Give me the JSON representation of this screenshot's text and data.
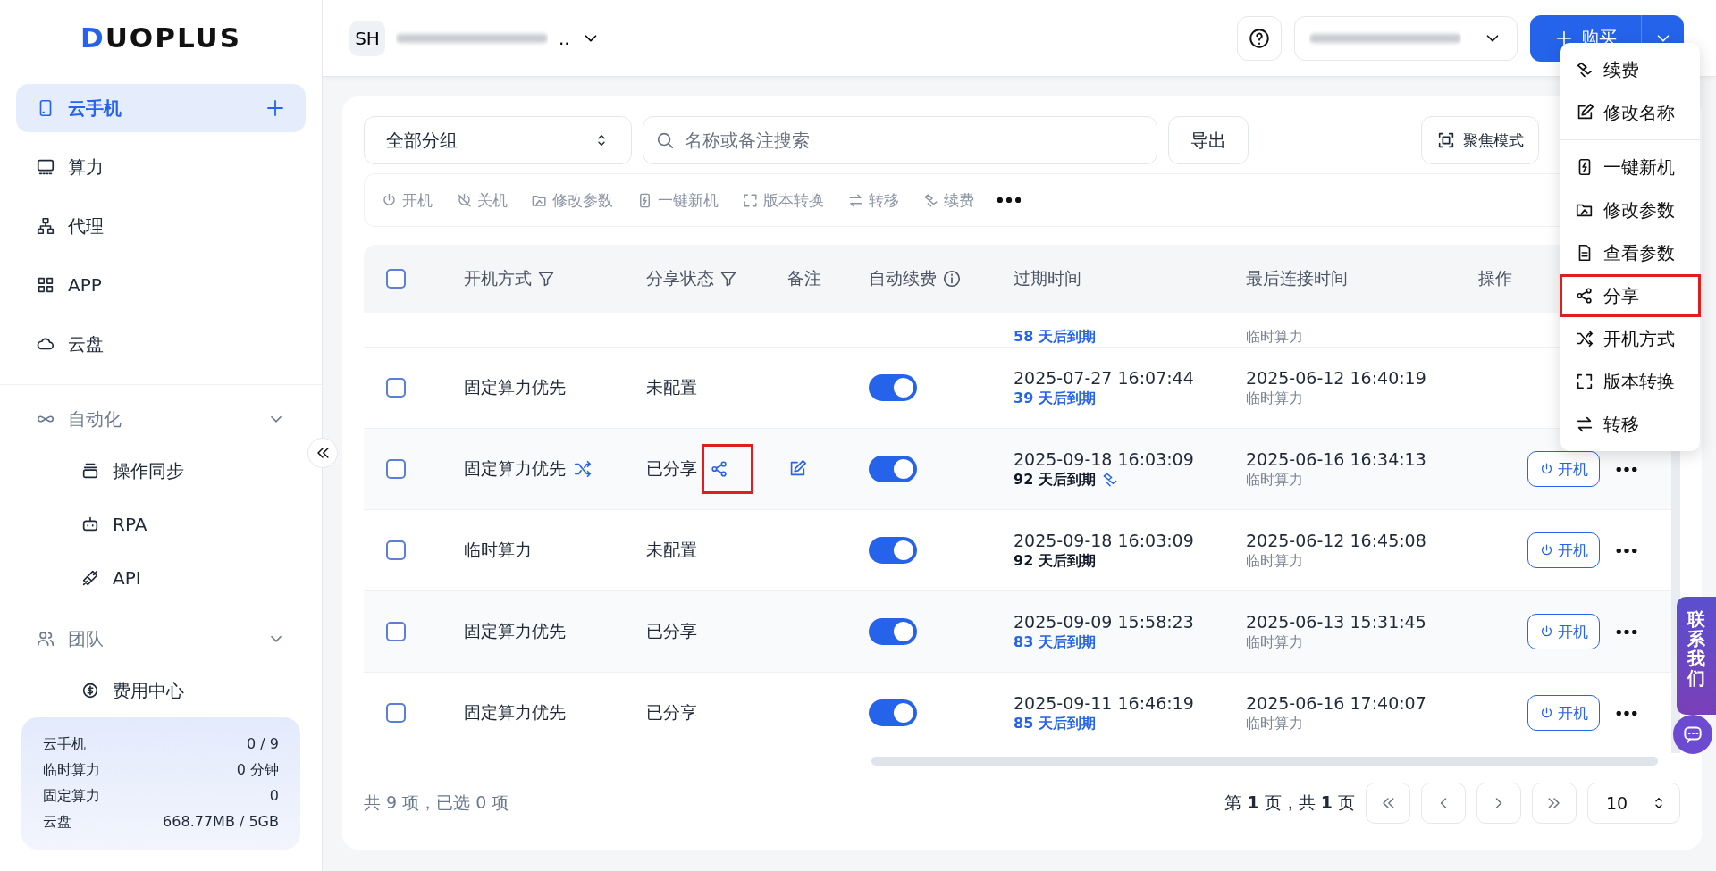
{
  "sidebar": {
    "logo": "DUOPLUS",
    "items": [
      {
        "label": "云手机",
        "selected": true
      },
      {
        "label": "算力",
        "selected": false
      },
      {
        "label": "代理",
        "selected": false
      },
      {
        "label": "APP",
        "selected": false
      },
      {
        "label": "云盘",
        "selected": false
      }
    ],
    "groups": [
      {
        "label": "自动化",
        "expanded": true,
        "children": [
          {
            "label": "操作同步"
          },
          {
            "label": "RPA"
          },
          {
            "label": "API"
          }
        ]
      },
      {
        "label": "团队",
        "expanded": true,
        "children": [
          {
            "label": "费用中心"
          }
        ]
      }
    ],
    "stats": [
      {
        "label": "云手机",
        "value": "0 / 9"
      },
      {
        "label": "临时算力",
        "value": "0 分钟"
      },
      {
        "label": "固定算力",
        "value": "0"
      },
      {
        "label": "云盘",
        "value": "668.77MB / 5GB"
      }
    ]
  },
  "header": {
    "avatar": "SH",
    "account_suffix": "..",
    "buy": "购买"
  },
  "filters": {
    "group": "全部分组",
    "search_placeholder": "名称或备注搜索",
    "export": "导出",
    "focus": "聚焦模式"
  },
  "toolbar": [
    "开机",
    "关机",
    "修改参数",
    "一键新机",
    "版本转换",
    "转移",
    "续费"
  ],
  "table": {
    "select_all_checked": false,
    "columns": [
      "开机方式",
      "分享状态",
      "备注",
      "自动续费",
      "过期时间",
      "最后连接时间",
      "操作"
    ],
    "rows": [
      {
        "kind": "partial",
        "expiry_note": "58 天后到期",
        "expiry_soon": true,
        "source": "临时算力"
      },
      {
        "kind": "full",
        "checked": false,
        "boot": "固定算力优先",
        "boot_icon": false,
        "share": "未配置",
        "share_icon": false,
        "share_highlighted": false,
        "note_icon": false,
        "auto_renew": true,
        "expiry": "2025-07-27 16:07:44",
        "expiry_note": "39 天后到期",
        "expiry_soon": true,
        "renew_icon": false,
        "last": "2025-06-12 16:40:19",
        "source": "临时算力"
      },
      {
        "kind": "full",
        "checked": false,
        "boot": "固定算力优先",
        "boot_icon": true,
        "share": "已分享",
        "share_icon": true,
        "share_highlighted": true,
        "note_icon": true,
        "auto_renew": true,
        "expiry": "2025-09-18 16:03:09",
        "expiry_note": "92 天后到期",
        "expiry_soon": false,
        "renew_icon": true,
        "last": "2025-06-16 16:34:13",
        "source": "临时算力",
        "action": "开机"
      },
      {
        "kind": "full",
        "checked": false,
        "boot": "临时算力",
        "boot_icon": false,
        "share": "未配置",
        "share_icon": false,
        "share_highlighted": false,
        "note_icon": false,
        "auto_renew": true,
        "expiry": "2025-09-18 16:03:09",
        "expiry_note": "92 天后到期",
        "expiry_soon": false,
        "renew_icon": false,
        "last": "2025-06-12 16:45:08",
        "source": "临时算力",
        "action": "开机"
      },
      {
        "kind": "full",
        "checked": false,
        "boot": "固定算力优先",
        "boot_icon": false,
        "share": "已分享",
        "share_icon": false,
        "share_highlighted": false,
        "note_icon": false,
        "auto_renew": true,
        "expiry": "2025-09-09 15:58:23",
        "expiry_note": "83 天后到期",
        "expiry_soon": true,
        "renew_icon": false,
        "last": "2025-06-13 15:31:45",
        "source": "临时算力",
        "action": "开机"
      },
      {
        "kind": "full",
        "checked": false,
        "boot": "固定算力优先",
        "boot_icon": false,
        "share": "已分享",
        "share_icon": false,
        "share_highlighted": false,
        "note_icon": false,
        "auto_renew": true,
        "expiry": "2025-09-11 16:46:19",
        "expiry_note": "85 天后到期",
        "expiry_soon": true,
        "renew_icon": false,
        "last": "2025-06-16 17:40:07",
        "source": "临时算力",
        "action": "开机"
      }
    ]
  },
  "footer": {
    "summary": "共 9 项，已选 0 项",
    "page": "第 **1** 页，共 **1** 页",
    "page_size": "10"
  },
  "menu": {
    "sections": [
      {
        "items": [
          {
            "label": "续费",
            "highlighted": false
          },
          {
            "label": "修改名称",
            "highlighted": false
          }
        ]
      },
      {
        "items": [
          {
            "label": "一键新机",
            "highlighted": false
          },
          {
            "label": "修改参数",
            "highlighted": false
          },
          {
            "label": "查看参数",
            "highlighted": false
          },
          {
            "label": "分享",
            "highlighted": true
          },
          {
            "label": "开机方式",
            "highlighted": false
          },
          {
            "label": "版本转换",
            "highlighted": false
          },
          {
            "label": "转移",
            "highlighted": false
          }
        ]
      }
    ]
  },
  "contact": {
    "label": "联系我们"
  }
}
